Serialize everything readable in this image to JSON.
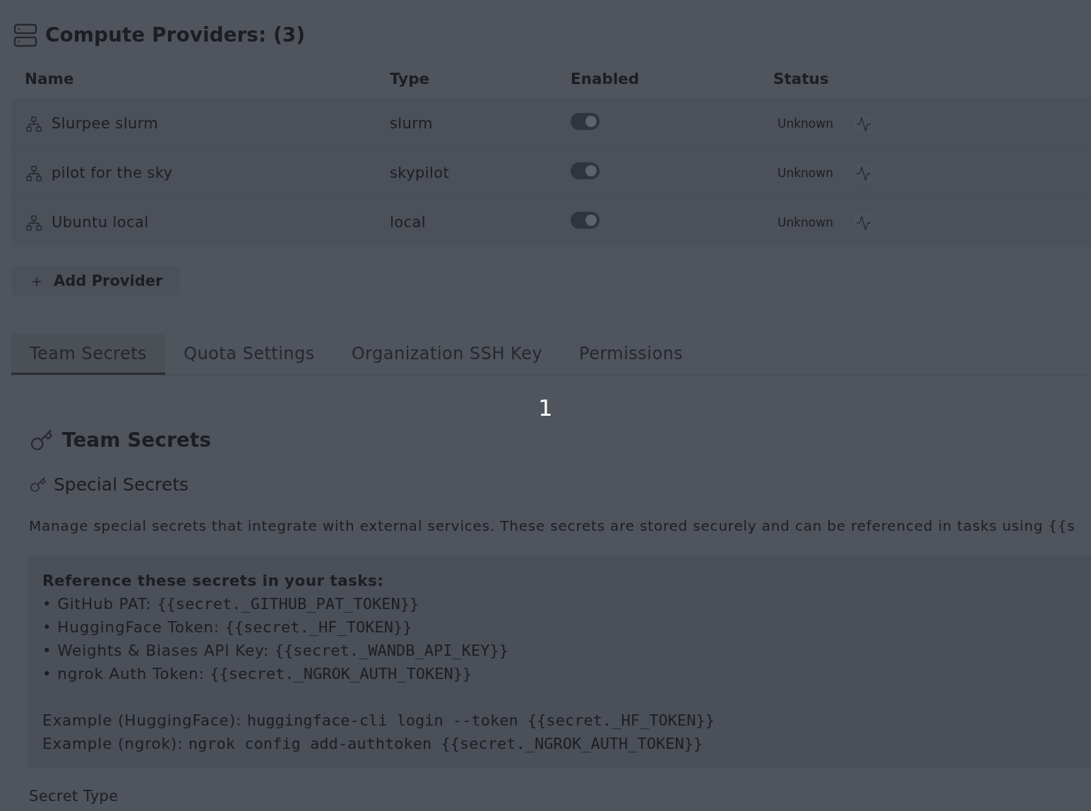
{
  "compute_providers": {
    "title": "Compute Providers: (3)",
    "columns": [
      "Name",
      "Type",
      "Enabled",
      "Status"
    ],
    "rows": [
      {
        "name": "Slurpee slurm",
        "type": "slurm",
        "enabled": true,
        "status": "Unknown"
      },
      {
        "name": "pilot for the sky",
        "type": "skypilot",
        "enabled": true,
        "status": "Unknown"
      },
      {
        "name": "Ubuntu local",
        "type": "local",
        "enabled": true,
        "status": "Unknown"
      }
    ],
    "add_button": "Add Provider"
  },
  "tabs": [
    {
      "label": "Team Secrets",
      "selected": true
    },
    {
      "label": "Quota Settings",
      "selected": false
    },
    {
      "label": "Organization SSH Key",
      "selected": false
    },
    {
      "label": "Permissions",
      "selected": false
    }
  ],
  "step_marker": "1",
  "team_secrets": {
    "title": "Team Secrets",
    "subtitle": "Special Secrets",
    "description": "Manage special secrets that integrate with external services. These secrets are stored securely and can be referenced in tasks using {{s",
    "reference": {
      "heading": "Reference these secrets in your tasks:",
      "items": [
        {
          "label": "• GitHub PAT:",
          "code": "{{secret._GITHUB_PAT_TOKEN}}"
        },
        {
          "label": "• HuggingFace Token:",
          "code": "{{secret._HF_TOKEN}}"
        },
        {
          "label": "• Weights & Biases API Key:",
          "code": "{{secret._WANDB_API_KEY}}"
        },
        {
          "label": "• ngrok Auth Token:",
          "code": "{{secret._NGROK_AUTH_TOKEN}}"
        }
      ],
      "examples": [
        {
          "label": "Example (HuggingFace):",
          "code": "huggingface-cli login --token {{secret._HF_TOKEN}}"
        },
        {
          "label": "Example (ngrok):",
          "code": "ngrok config add-authtoken {{secret._NGROK_AUTH_TOKEN}}"
        }
      ]
    },
    "field_label": "Secret Type"
  }
}
